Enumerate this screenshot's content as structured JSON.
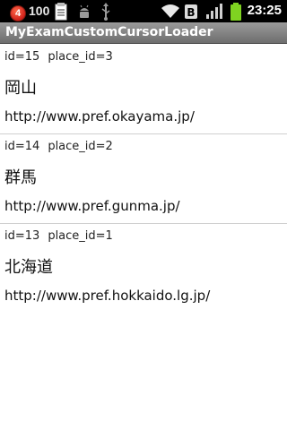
{
  "status_bar": {
    "notification_badge": "4",
    "notification_count": "100",
    "time": "23:25",
    "icons": [
      "notes-icon",
      "android-debug-icon",
      "usb-icon",
      "wifi-icon",
      "notification-b-icon",
      "signal-icon",
      "battery-icon"
    ]
  },
  "app": {
    "title": "MyExamCustomCursorLoader"
  },
  "items": [
    {
      "id": "id=15",
      "place_id": "place_id=3",
      "name": "岡山",
      "url": "http://www.pref.okayama.jp/"
    },
    {
      "id": "id=14",
      "place_id": "place_id=2",
      "name": "群馬",
      "url": "http://www.pref.gunma.jp/"
    },
    {
      "id": "id=13",
      "place_id": "place_id=1",
      "name": "北海道",
      "url": "http://www.pref.hokkaido.lg.jp/"
    }
  ],
  "colors": {
    "status_bar_bg": "#000000",
    "title_bar_bg": "#7a7a7a",
    "battery_green": "#7fd321",
    "badge_red": "#d0201a"
  }
}
